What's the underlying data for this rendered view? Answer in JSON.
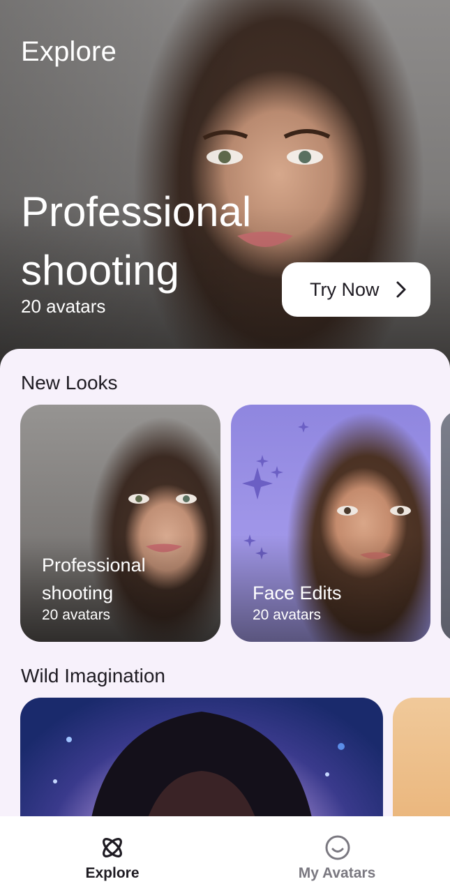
{
  "header": {
    "title": "Explore"
  },
  "hero": {
    "title": "Professional shooting",
    "subtitle": "20 avatars",
    "button_label": "Try Now"
  },
  "sections": [
    {
      "title": "New Looks",
      "cards": [
        {
          "title": "Professional shooting",
          "subtitle": "20 avatars"
        },
        {
          "title": "Face Edits",
          "subtitle": "20 avatars"
        }
      ]
    },
    {
      "title": "Wild Imagination"
    }
  ],
  "nav": {
    "items": [
      {
        "label": "Explore",
        "icon": "atom-icon",
        "active": true
      },
      {
        "label": "My Avatars",
        "icon": "smiley-face-icon",
        "active": false
      }
    ]
  },
  "colors": {
    "background": "#f7f1fb",
    "text_primary": "#1e1b22",
    "nav_inactive": "#7a7880",
    "card_purple": "#9f95e8"
  }
}
